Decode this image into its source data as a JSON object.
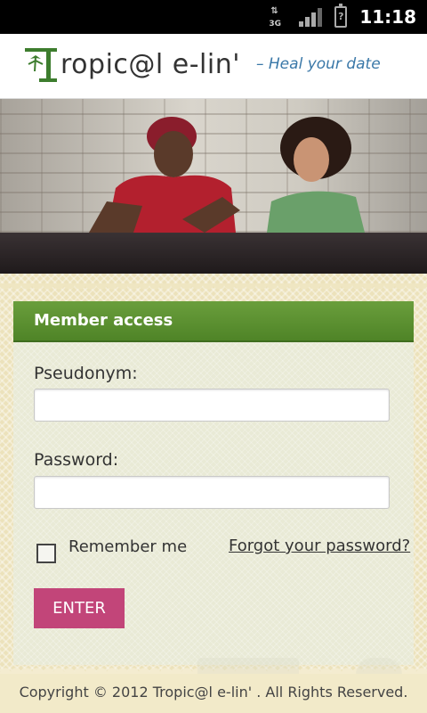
{
  "status_bar": {
    "network_label": "3G",
    "time": "11:18",
    "icons": [
      "data-transfer-icon",
      "signal-icon",
      "battery-unknown-icon"
    ]
  },
  "header": {
    "logo_text": "ropic@l e-lin'",
    "tagline": "– Heal your date"
  },
  "login": {
    "title": "Member access",
    "pseudonym_label": "Pseudonym:",
    "pseudonym_value": "",
    "password_label": "Password:",
    "password_value": "",
    "remember_label": "Remember me",
    "remember_checked": false,
    "forgot_link": "Forgot your password?",
    "enter_button": "ENTER"
  },
  "footer": {
    "copyright": "Copyright © 2012 Tropic@l e-lin' . All Rights Reserved."
  },
  "colors": {
    "panel_header": "#5a8f30",
    "button": "#c24579",
    "tagline": "#3a78a8"
  }
}
